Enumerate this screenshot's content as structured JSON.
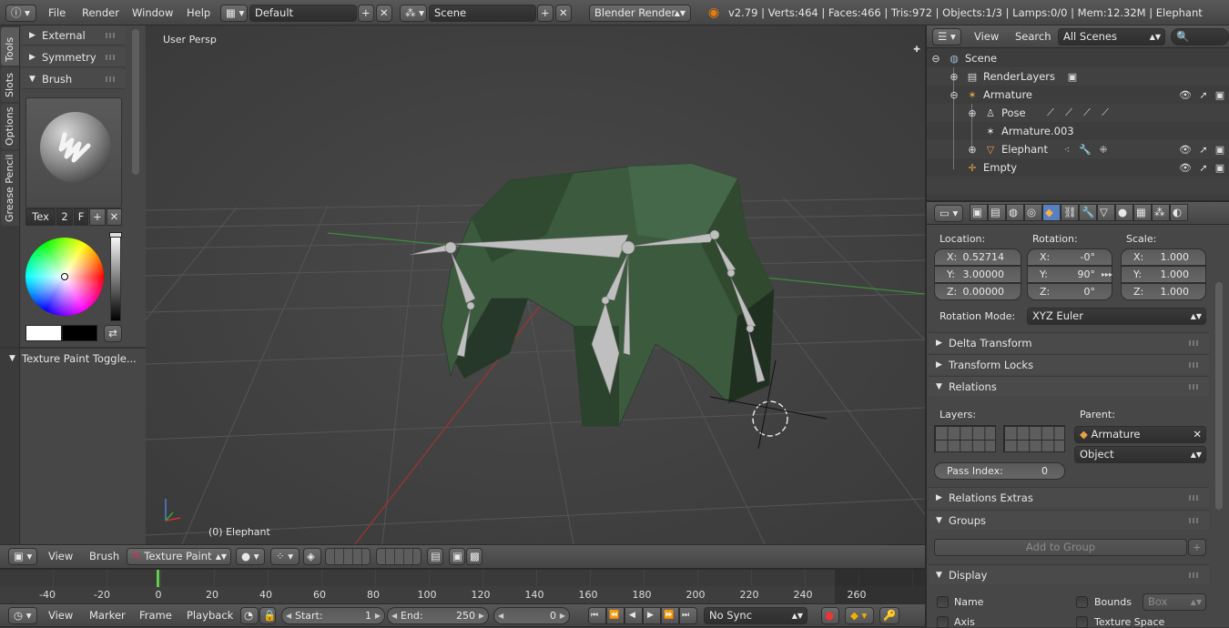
{
  "top": {
    "menus": [
      "File",
      "Render",
      "Window",
      "Help"
    ],
    "layout": "Default",
    "scene": "Scene",
    "engine": "Blender Render",
    "stats": "v2.79 | Verts:464 | Faces:466 | Tris:972 | Objects:1/3 | Lamps:0/0 | Mem:12.32M | Elephant"
  },
  "tools": {
    "vtabs": [
      "Tools",
      "Slots",
      "Options",
      "Grease Pencil"
    ],
    "panels": [
      "External",
      "Symmetry",
      "Brush"
    ],
    "brush_tex": "Tex",
    "brush_users": "2",
    "brush_fake": "F",
    "texture_paint_toggle": "Texture Paint Toggle..."
  },
  "viewport": {
    "view_label": "User Persp",
    "object_label": "(0) Elephant"
  },
  "view_header": {
    "view": "View",
    "brush": "Brush",
    "mode": "Texture Paint"
  },
  "timeline": {
    "ticks": [
      "-40",
      "-20",
      "0",
      "20",
      "40",
      "60",
      "80",
      "100",
      "120",
      "140",
      "160",
      "180",
      "200",
      "220",
      "240",
      "260"
    ],
    "menus": [
      "View",
      "Marker",
      "Frame",
      "Playback"
    ],
    "start_label": "Start:",
    "start": "1",
    "end_label": "End:",
    "end": "250",
    "current": "0",
    "sync": "No Sync"
  },
  "outliner": {
    "view": "View",
    "search": "Search",
    "filter": "All Scenes",
    "rows": [
      "Scene",
      "RenderLayers",
      "Armature",
      "Pose",
      "Armature.003",
      "Elephant",
      "Empty"
    ]
  },
  "props": {
    "location_label": "Location:",
    "rotation_label": "Rotation:",
    "scale_label": "Scale:",
    "loc": [
      {
        "axis": "X:",
        "val": "0.52714"
      },
      {
        "axis": "Y:",
        "val": "3.00000"
      },
      {
        "axis": "Z:",
        "val": "0.00000"
      }
    ],
    "rot": [
      {
        "axis": "X:",
        "val": "-0°"
      },
      {
        "axis": "Y:",
        "val": "90°"
      },
      {
        "axis": "Z:",
        "val": "0°"
      }
    ],
    "scl": [
      {
        "axis": "X:",
        "val": "1.000"
      },
      {
        "axis": "Y:",
        "val": "1.000"
      },
      {
        "axis": "Z:",
        "val": "1.000"
      }
    ],
    "rotation_mode_label": "Rotation Mode:",
    "rotation_mode": "XYZ Euler",
    "delta_transform": "Delta Transform",
    "transform_locks": "Transform Locks",
    "relations": "Relations",
    "layers_label": "Layers:",
    "parent_label": "Parent:",
    "parent": "Armature",
    "parent_type": "Object",
    "pass_index_label": "Pass Index:",
    "pass_index": "0",
    "relations_extras": "Relations Extras",
    "groups": "Groups",
    "add_to_group": "Add to Group",
    "display": "Display",
    "name": "Name",
    "bounds": "Bounds",
    "bounds_type": "Box",
    "axis": "Axis",
    "texture_space": "Texture Space"
  }
}
